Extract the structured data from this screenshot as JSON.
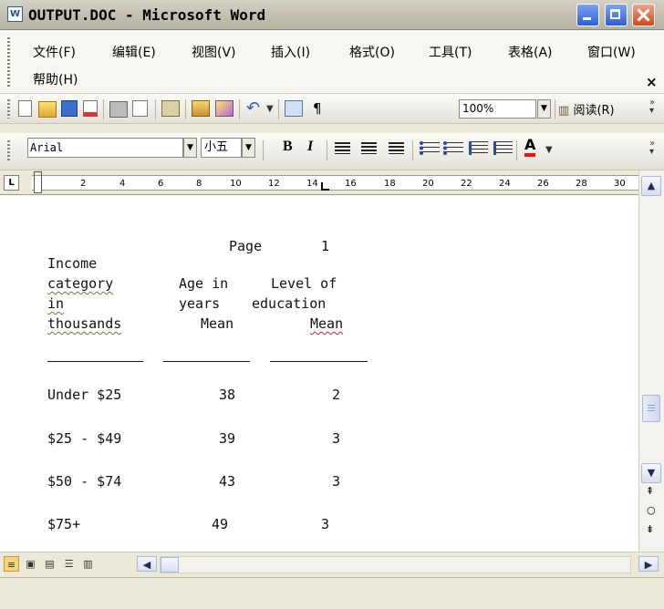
{
  "window": {
    "title": "OUTPUT.DOC - Microsoft Word",
    "app_icon": "W"
  },
  "menu": {
    "items": [
      "文件(F)",
      "编辑(E)",
      "视图(V)",
      "插入(I)",
      "格式(O)",
      "工具(T)",
      "表格(A)",
      "窗口(W)",
      "帮助(H)"
    ],
    "close_glyph": "×"
  },
  "standard_toolbar": {
    "zoom": "100%",
    "reading_label": "阅读(R)"
  },
  "formatting_toolbar": {
    "font": "Arial",
    "size": "小五",
    "bold": "B",
    "italic": "I",
    "font_color_label": "A"
  },
  "ruler": {
    "numbers": [
      "2",
      "4",
      "6",
      "8",
      "10",
      "12",
      "14",
      "16",
      "18",
      "20",
      "22",
      "24",
      "26",
      "28",
      "30"
    ]
  },
  "document": {
    "page_label": "Page",
    "page_number": "1",
    "headers": {
      "col1": [
        "Income",
        "category",
        "in",
        "thousands"
      ],
      "col2": [
        "Age in",
        "years",
        "Mean"
      ],
      "col3": [
        "Level of",
        "education",
        "Mean"
      ]
    },
    "rows": [
      {
        "income": "Under $25",
        "age": "38",
        "education": "2"
      },
      {
        "income": "$25 - $49",
        "age": "39",
        "education": "3"
      },
      {
        "income": "$50 - $74",
        "age": "43",
        "education": "3"
      },
      {
        "income": "$75+",
        "age": "49",
        "education": "3"
      }
    ]
  },
  "colors": {
    "titlebar": "#c2beb0",
    "close_button": "#d4471b",
    "minmax_button": "#2c5fd7",
    "spellcheck_squiggle": "#5b7f3a"
  }
}
